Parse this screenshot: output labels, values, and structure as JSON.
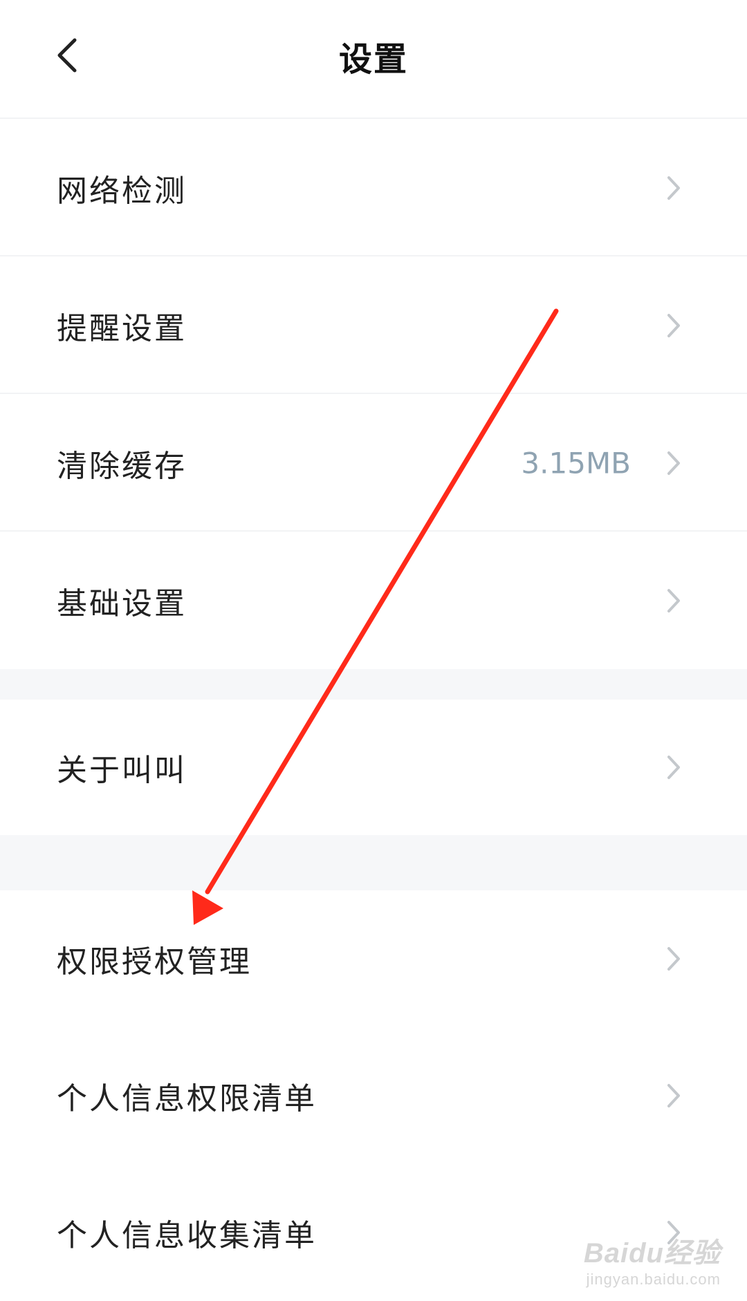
{
  "header": {
    "back_icon": "chevron-left-icon",
    "title": "设置"
  },
  "groups": [
    {
      "items": [
        {
          "label": "网络检测",
          "value": "",
          "icon": "chevron-right-icon"
        },
        {
          "label": "提醒设置",
          "value": "",
          "icon": "chevron-right-icon"
        },
        {
          "label": "清除缓存",
          "value": "3.15MB",
          "icon": "chevron-right-icon"
        },
        {
          "label": "基础设置",
          "value": "",
          "icon": "chevron-right-icon"
        }
      ]
    },
    {
      "items": [
        {
          "label": "关于叫叫",
          "value": "",
          "icon": "chevron-right-icon"
        }
      ]
    },
    {
      "items": [
        {
          "label": "权限授权管理",
          "value": "",
          "icon": "chevron-right-icon"
        },
        {
          "label": "个人信息权限清单",
          "value": "",
          "icon": "chevron-right-icon"
        },
        {
          "label": "个人信息收集清单",
          "value": "",
          "icon": "chevron-right-icon"
        }
      ]
    }
  ],
  "annotation": {
    "icon": "red-arrow-annotation",
    "color": "#ff2a1a"
  },
  "watermark": {
    "logo": "Baidu经验",
    "url": "jingyan.baidu.com"
  },
  "colors": {
    "background": "#ffffff",
    "section_gap": "#f6f7f9",
    "divider": "#f2f3f5",
    "label_text": "#222222",
    "value_text": "#8fa3b2",
    "chevron": "#c4c8cc"
  }
}
